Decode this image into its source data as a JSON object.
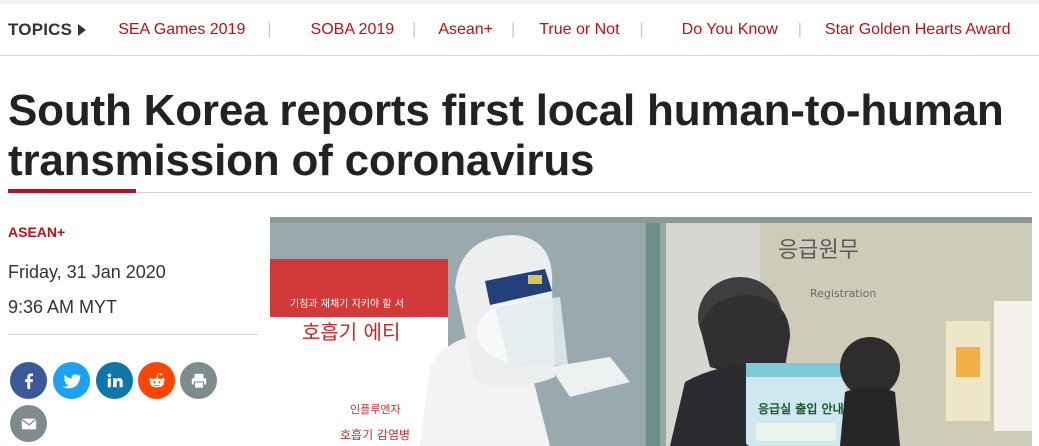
{
  "topics": {
    "label": "TOPICS",
    "items": [
      "SEA Games 2019",
      "SOBA 2019",
      "Asean+",
      "True or Not",
      "Do You Know",
      "Star Golden Hearts Award"
    ],
    "separator": "|"
  },
  "article": {
    "headline_line1": "South Korea reports first local human-to-human",
    "headline_line2": "transmission of coronavirus",
    "category": "ASEAN+",
    "date": "Friday, 31 Jan 2020",
    "time": "9:36 AM MYT"
  },
  "share": [
    {
      "name": "facebook",
      "glyph": "f",
      "color": "#3b5998"
    },
    {
      "name": "twitter",
      "glyph": "t",
      "color": "#1da1f2"
    },
    {
      "name": "linkedin",
      "glyph": "in",
      "color": "#0e76a8"
    },
    {
      "name": "reddit",
      "glyph": "r",
      "color": "#ff4500"
    },
    {
      "name": "print",
      "glyph": "p",
      "color": "#7f8c8d"
    },
    {
      "name": "email",
      "glyph": "e",
      "color": "#7f8c8d"
    }
  ],
  "photo": {
    "sign_line1": "기침과 재채기 지키야 할 서",
    "sign_line2": "호흡기 에티",
    "sign_line3": "인플루엔자",
    "sign_line4": "호흡기 감염병",
    "wall_text": "응급원무",
    "wall_sub": "Registration",
    "notice_title": "응급실 출입 안내"
  }
}
